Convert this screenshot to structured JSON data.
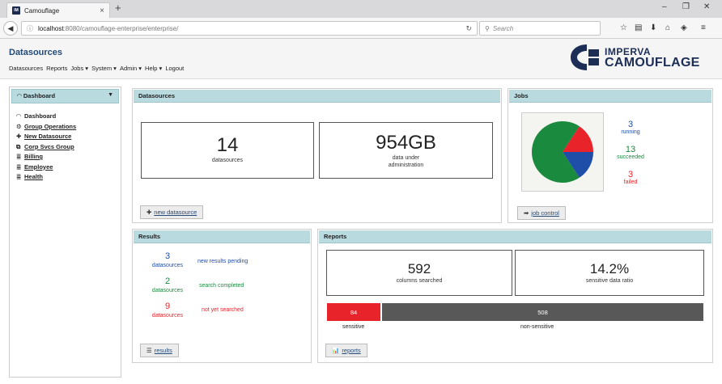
{
  "browser": {
    "tab_title": "Camouflage",
    "tab_favicon": "IM",
    "url_host": "localhost",
    "url_path": ":8080/camouflage-enterprise/enterprise/",
    "search_placeholder": "Search"
  },
  "header": {
    "title": "Datasources",
    "menu": [
      "Datasources",
      "Reports",
      "Jobs ▾",
      "System ▾",
      "Admin ▾",
      "Help ▾",
      "Logout"
    ],
    "logo_line1": "IMPERVA",
    "logo_line2": "CAMOUFLAGE"
  },
  "sidebar": {
    "title": "Dashboard",
    "items": [
      {
        "label": "Dashboard",
        "icon": "gauge-icon"
      },
      {
        "label": "Group Operations",
        "icon": "gears-icon"
      },
      {
        "label": "New Datasource",
        "icon": "plus-icon"
      },
      {
        "label": "Corp Svcs Group",
        "icon": "group-icon"
      },
      {
        "label": "Billing",
        "icon": "database-icon"
      },
      {
        "label": "Employee",
        "icon": "database-icon"
      },
      {
        "label": "Health",
        "icon": "database-icon"
      }
    ]
  },
  "datasources_panel": {
    "title": "Datasources",
    "count_value": "14",
    "count_label": "datasources",
    "size_value": "954GB",
    "size_label_1": "data under",
    "size_label_2": "administration",
    "button_label": "new datasource"
  },
  "jobs_panel": {
    "title": "Jobs",
    "running_value": "3",
    "running_label": "running",
    "succeeded_value": "13",
    "succeeded_label": "succeeded",
    "failed_value": "3",
    "failed_label": "failed",
    "button_label": "job control"
  },
  "chart_data": {
    "type": "pie",
    "series": [
      {
        "name": "succeeded",
        "values": [
          13
        ]
      },
      {
        "name": "running",
        "values": [
          3
        ]
      },
      {
        "name": "failed",
        "values": [
          3
        ]
      }
    ],
    "slices": [
      {
        "label": "succeeded",
        "value": 13,
        "color": "#1a8a3e"
      },
      {
        "label": "running",
        "value": 3,
        "color": "#1f4ea8"
      },
      {
        "label": "failed",
        "value": 3,
        "color": "#e8232a"
      }
    ]
  },
  "results_panel": {
    "title": "Results",
    "rows": [
      {
        "value": "3",
        "unit": "datasources",
        "message": "new results pending",
        "color": "#1f4ea8"
      },
      {
        "value": "2",
        "unit": "datasources",
        "message": "search completed",
        "color": "#1a8a3e"
      },
      {
        "value": "9",
        "unit": "datasources",
        "message": "not yet searched",
        "color": "#e8232a"
      }
    ],
    "button_label": "results"
  },
  "reports_panel": {
    "title": "Reports",
    "columns_value": "592",
    "columns_label": "columns searched",
    "ratio_value": "14.2%",
    "ratio_label": "sensitive data ratio",
    "sensitive_value": "84",
    "sensitive_label": "sensitive",
    "nonsensitive_value": "508",
    "nonsensitive_label": "non-sensitive",
    "button_label": "reports"
  },
  "colors": {
    "panel_header": "#b9dbe0",
    "title_blue": "#234a78",
    "blue": "#1f4ea8",
    "green": "#1a8a3e",
    "red": "#e8232a",
    "dark_gray": "#585858"
  }
}
